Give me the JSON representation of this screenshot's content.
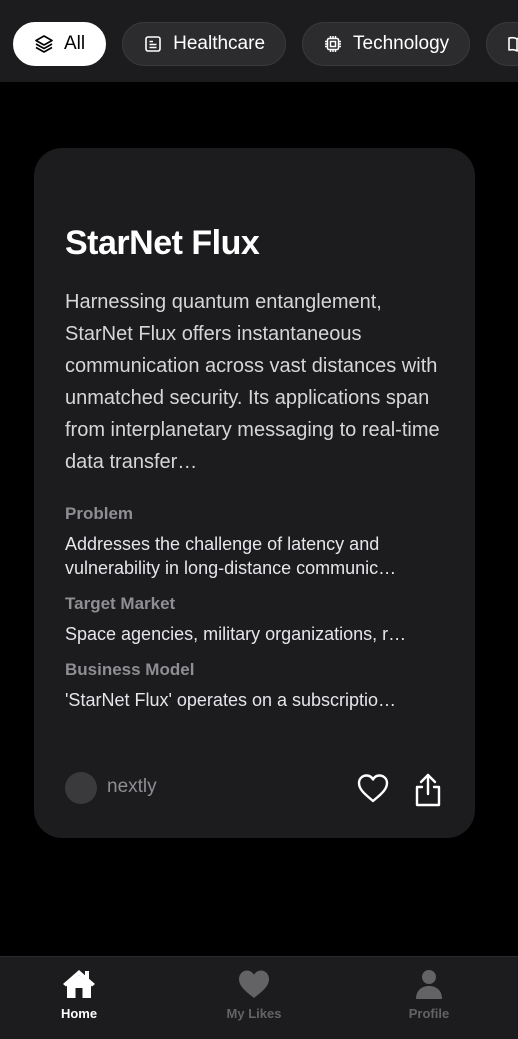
{
  "categories": [
    {
      "label": "All",
      "icon": "layers-icon",
      "active": true
    },
    {
      "label": "Healthcare",
      "icon": "document-icon",
      "active": false
    },
    {
      "label": "Technology",
      "icon": "cpu-chip-icon",
      "active": false
    },
    {
      "label": "",
      "icon": "book-icon",
      "active": false
    }
  ],
  "card": {
    "title": "StarNet Flux",
    "description": "Harnessing quantum entanglement, StarNet Flux offers instantaneous communication across vast distances with unmatched security. Its applications span from interplanetary messaging to real-time data transfer…",
    "sections": [
      {
        "label": "Problem",
        "value": "Addresses the challenge of latency and vulnerability in long-distance communic…"
      },
      {
        "label": "Target Market",
        "value": "Space agencies, military organizations, r…"
      },
      {
        "label": "Business Model",
        "value": "'StarNet Flux' operates on a subscriptio…"
      }
    ],
    "author": "nextly"
  },
  "tabbar": {
    "home": "Home",
    "likes": "My Likes",
    "profile": "Profile"
  },
  "colors": {
    "background": "#000000",
    "surface": "#1c1c1e",
    "muted": "#8e8e93"
  }
}
